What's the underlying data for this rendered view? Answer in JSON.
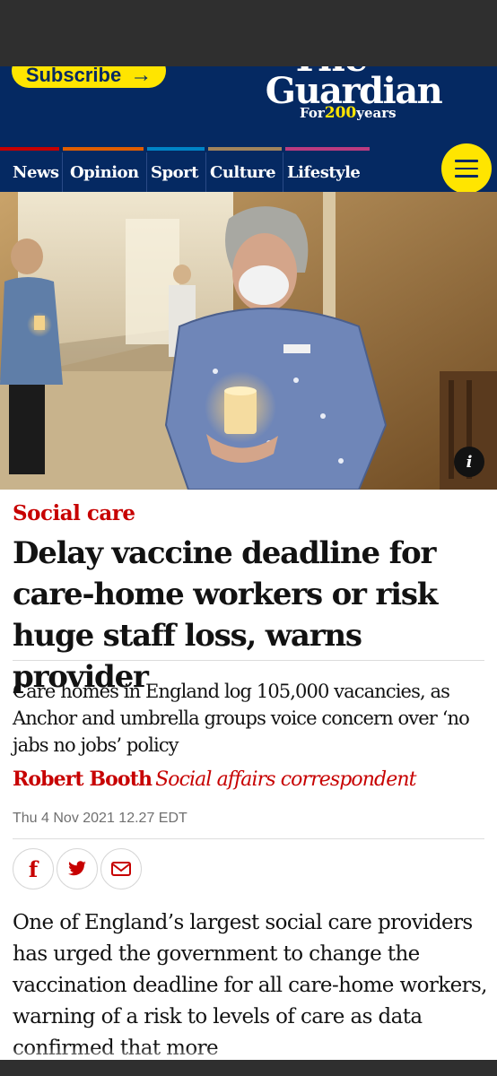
{
  "masthead": {
    "subscribe_label": "Subscribe",
    "subscribe_arrow": "→",
    "logo_the": "The",
    "logo_name": "Guardian",
    "logo_for": "For",
    "logo_number": "200",
    "logo_years": "years"
  },
  "nav": {
    "pillars": [
      {
        "label": "News",
        "accent": "#c70000"
      },
      {
        "label": "Opinion",
        "accent": "#e05e00"
      },
      {
        "label": "Sport",
        "accent": "#0084c6"
      },
      {
        "label": "Culture",
        "accent": "#a1845c"
      },
      {
        "label": "Lifestyle",
        "accent": "#bb3b80"
      }
    ],
    "menu_icon": "hamburger-icon"
  },
  "hero": {
    "info_label": "i"
  },
  "article": {
    "kicker": "Social care",
    "headline": "Delay vaccine deadline for care-home workers or risk huge staff loss, warns provider",
    "standfirst": "Care homes in England log 105,000 vacancies, as Anchor and umbrella groups voice concern over ‘no jabs no jobs’ policy",
    "author": "Robert Booth",
    "author_role": "Social affairs correspondent",
    "date": "Thu 4 Nov 2021 12.27 EDT",
    "share": [
      {
        "icon": "facebook-icon",
        "glyph": "f"
      },
      {
        "icon": "twitter-icon",
        "glyph": "t"
      },
      {
        "icon": "email-icon",
        "glyph": "✉"
      }
    ],
    "body_first_paragraph": "One of England’s largest social care providers has urged the government to change the vaccination deadline for all care-home workers, warning of a risk to levels of care as data confirmed that more"
  },
  "colors": {
    "brand_blue": "#052962",
    "accent_yellow": "#ffe500",
    "news_red": "#c70000"
  }
}
